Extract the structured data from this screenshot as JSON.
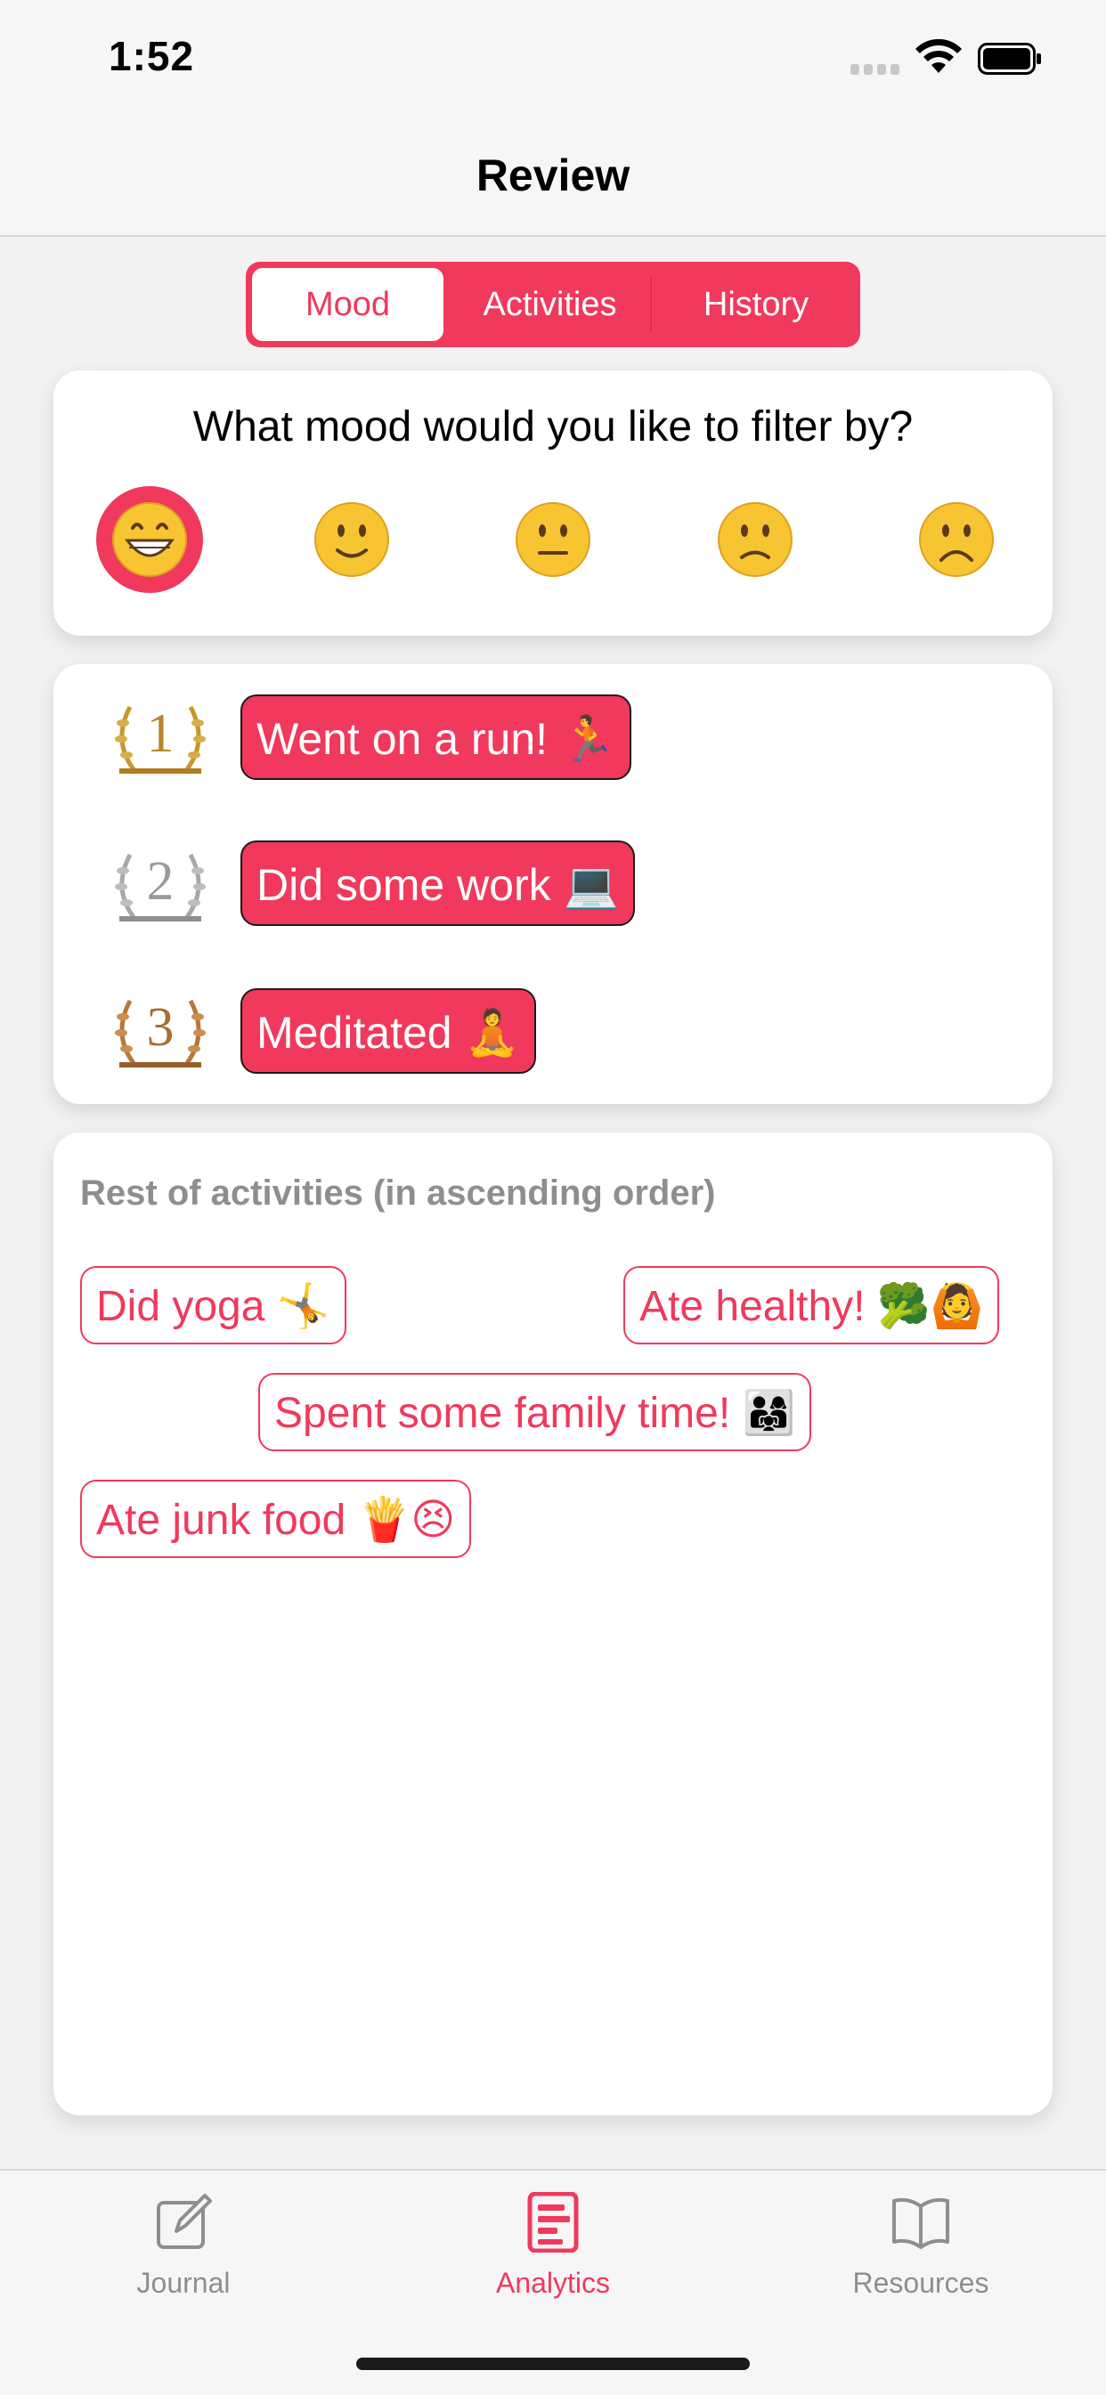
{
  "status": {
    "time": "1:52"
  },
  "nav": {
    "title": "Review"
  },
  "segments": [
    {
      "label": "Mood",
      "selected": true
    },
    {
      "label": "Activities",
      "selected": false
    },
    {
      "label": "History",
      "selected": false
    }
  ],
  "filter": {
    "question": "What mood would you like to filter by?",
    "moods": [
      {
        "icon": "grinning-face-icon",
        "selected": true
      },
      {
        "icon": "slightly-smiling-face-icon",
        "selected": false
      },
      {
        "icon": "neutral-face-icon",
        "selected": false
      },
      {
        "icon": "slightly-frowning-face-icon",
        "selected": false
      },
      {
        "icon": "frowning-face-icon",
        "selected": false
      }
    ]
  },
  "top_activities": [
    {
      "rank": "1",
      "label": "Went on a run! 🏃",
      "medal": "gold"
    },
    {
      "rank": "2",
      "label": "Did some work 💻",
      "medal": "silver"
    },
    {
      "rank": "3",
      "label": "Meditated 🧘",
      "medal": "bronze"
    }
  ],
  "rest": {
    "title": "Rest of activities (in ascending order)",
    "tags": [
      "Did yoga 🤸",
      "Ate healthy! 🥦🙆",
      "Spent some family time! 👨‍👩‍👧",
      "Ate junk food 🍟😣"
    ]
  },
  "tabs": [
    {
      "label": "Journal",
      "icon": "compose-icon",
      "active": false
    },
    {
      "label": "Analytics",
      "icon": "analytics-icon",
      "active": true
    },
    {
      "label": "Resources",
      "icon": "book-icon",
      "active": false
    }
  ],
  "colors": {
    "accent": "#f0395c",
    "gold": "#c9962e",
    "silver": "#a8a8a8",
    "bronze": "#b5773a"
  }
}
